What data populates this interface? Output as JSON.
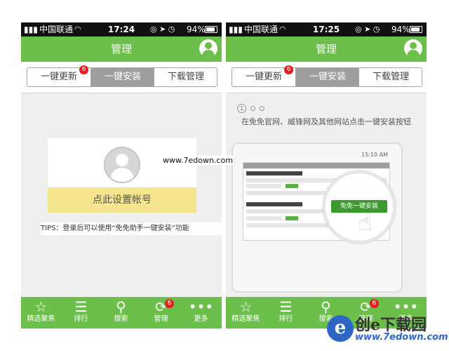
{
  "status_left": {
    "carrier": "中国联通",
    "time": "17:24",
    "battery": "94%"
  },
  "status_right": {
    "carrier": "中国联通",
    "time": "17:25",
    "battery": "94%"
  },
  "nav": {
    "title": "管理"
  },
  "segments": [
    {
      "label": "一键更新",
      "badge": "6"
    },
    {
      "label": "一键安装"
    },
    {
      "label": "下载管理"
    }
  ],
  "left_page": {
    "setup_label": "点此设置帐号",
    "tips": "TIPS：登录后可以使用“免免助手一键安装”功能"
  },
  "right_page": {
    "step": "1",
    "instruction": "在免免官网、威锋网及其他网站点击一键安装按钮",
    "tablet_time": "15:10 AM",
    "install_button": "免免一键安装"
  },
  "watermark_mid": "www.7edown.com",
  "tabs": [
    {
      "label": "精选聚焦",
      "icon": "star-icon"
    },
    {
      "label": "排行",
      "icon": "list-icon"
    },
    {
      "label": "搜索",
      "icon": "search-icon"
    },
    {
      "label": "管理",
      "icon": "refresh-icon",
      "badge": "6"
    },
    {
      "label": "更多",
      "icon": "more-icon"
    }
  ],
  "logo": {
    "title": "创e下载园",
    "url": "www.7edown.com",
    "mark": "e"
  },
  "colors": {
    "accent": "#6cbf4b",
    "badge": "#e41e1e",
    "highlight": "#f5e58e"
  }
}
